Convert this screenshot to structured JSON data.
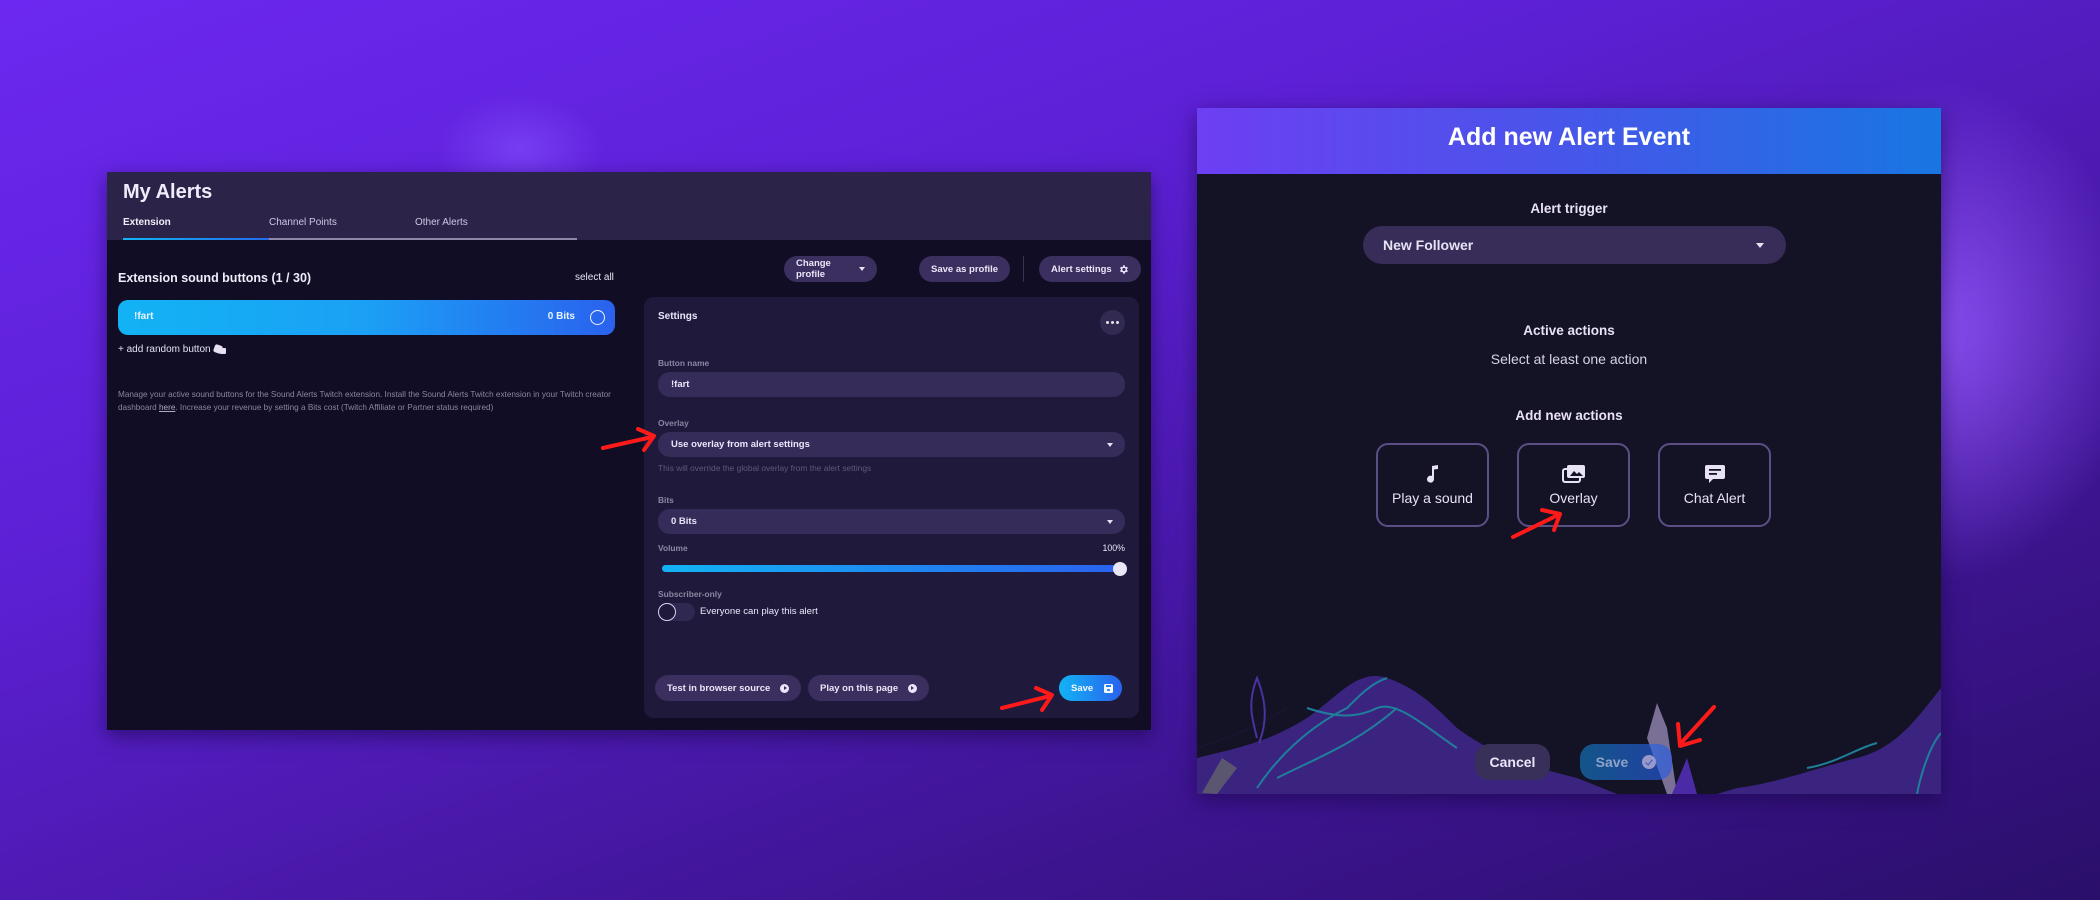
{
  "left_panel": {
    "title": "My Alerts",
    "tabs": [
      {
        "label": "Extension",
        "active": true
      },
      {
        "label": "Channel Points",
        "active": false
      },
      {
        "label": "Other Alerts",
        "active": false
      }
    ],
    "section_title": "Extension sound buttons (1 / 30)",
    "select_all": "select all",
    "sound_buttons": [
      {
        "name": "!fart",
        "bits": "0 Bits"
      }
    ],
    "add_random": "+ add random button",
    "description_pre": "Manage your active sound buttons for the Sound Alerts Twitch extension. Install the Sound Alerts Twitch extension in your Twitch creator dashboard ",
    "description_link": "here",
    "description_post": ". Increase your revenue by setting a Bits cost (Twitch Affiliate or Partner status required)",
    "toolbar": {
      "change_profile": "Change profile",
      "save_as_profile": "Save as profile",
      "alert_settings": "Alert settings"
    },
    "settings": {
      "title": "Settings",
      "button_name_label": "Button name",
      "button_name_value": "!fart",
      "overlay_label": "Overlay",
      "overlay_value": "Use overlay from alert settings",
      "overlay_hint": "This will override the global overlay from the alert settings",
      "bits_label": "Bits",
      "bits_value": "0 Bits",
      "volume_label": "Volume",
      "volume_display": "100%",
      "volume_percent": 100,
      "subscriber_label": "Subscriber-only",
      "subscriber_only": false,
      "subscriber_text": "Everyone can play this alert",
      "test_browser": "Test in browser source",
      "play_page": "Play on this page",
      "save": "Save"
    }
  },
  "modal": {
    "title": "Add new Alert Event",
    "trigger_label": "Alert trigger",
    "trigger_value": "New Follower",
    "active_actions_label": "Active actions",
    "active_actions_hint": "Select at least one action",
    "add_actions_label": "Add new actions",
    "actions": [
      {
        "label": "Play a sound",
        "icon": "music-note-icon"
      },
      {
        "label": "Overlay",
        "icon": "images-icon"
      },
      {
        "label": "Chat Alert",
        "icon": "chat-bubble-icon"
      }
    ],
    "cancel": "Cancel",
    "save": "Save"
  },
  "colors": {
    "accent_gradient_start": "#12b3f4",
    "accent_gradient_end": "#2a62ee",
    "annotation_arrow": "#ff1a1a"
  }
}
